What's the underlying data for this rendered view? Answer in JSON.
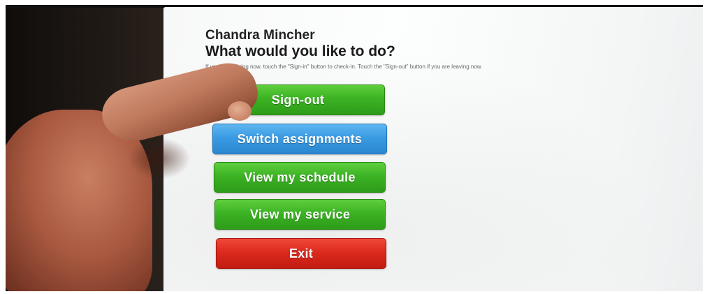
{
  "header": {
    "user_name": "Chandra Mincher",
    "prompt": "What would you like to do?",
    "instructions": "If you are arriving now, touch the \"Sign-in\" button to check-in. Touch the \"Sign-out\" button if you are leaving now."
  },
  "actions": [
    {
      "label": "Sign-out",
      "color": "#3cb324"
    },
    {
      "label": "Switch assignments",
      "color": "#3a9be3"
    },
    {
      "label": "View my schedule",
      "color": "#3cb324"
    },
    {
      "label": "View my service",
      "color": "#3cb324"
    },
    {
      "label": "Exit",
      "color": "#dc2a1e"
    }
  ]
}
